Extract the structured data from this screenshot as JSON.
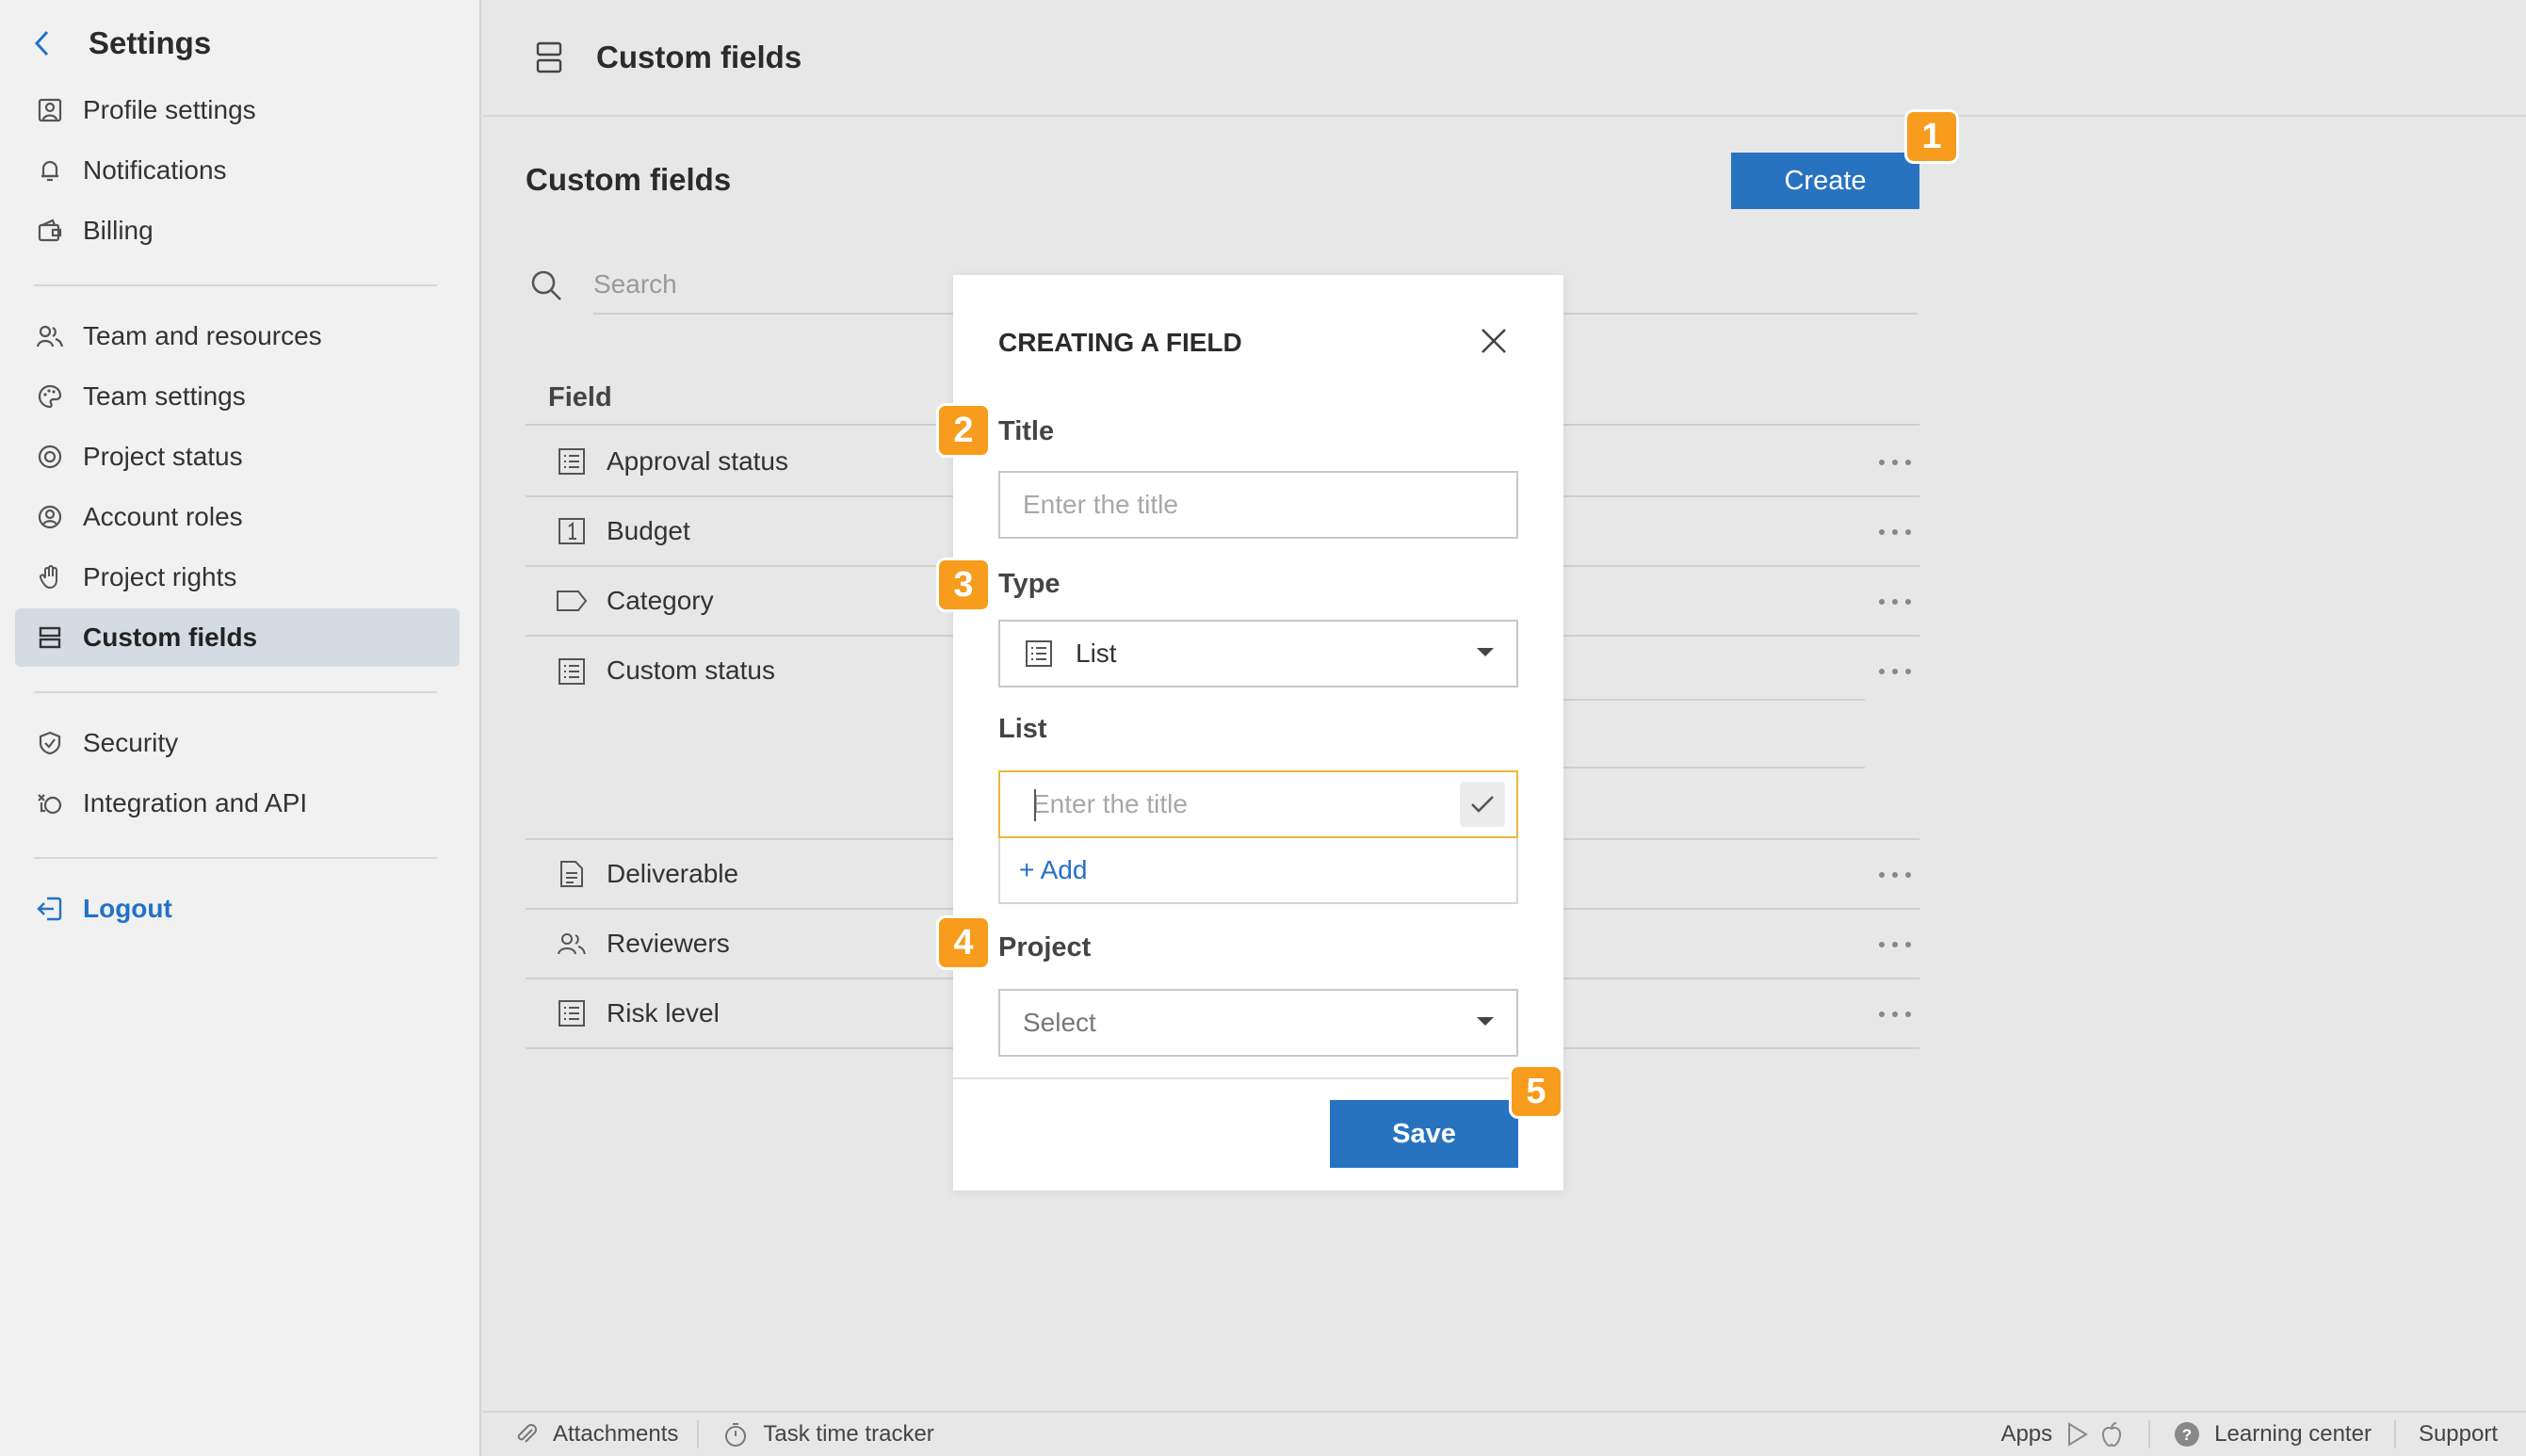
{
  "sidebar": {
    "title": "Settings",
    "items": [
      {
        "label": "Profile settings",
        "icon": "profile-icon"
      },
      {
        "label": "Notifications",
        "icon": "bell-icon"
      },
      {
        "label": "Billing",
        "icon": "wallet-icon"
      },
      {
        "label": "Team and resources",
        "icon": "team-icon"
      },
      {
        "label": "Team settings",
        "icon": "palette-icon"
      },
      {
        "label": "Project status",
        "icon": "project-status-icon"
      },
      {
        "label": "Account roles",
        "icon": "user-circle-icon"
      },
      {
        "label": "Project rights",
        "icon": "hand-icon"
      },
      {
        "label": "Custom fields",
        "icon": "custom-fields-icon",
        "active": true
      },
      {
        "label": "Security",
        "icon": "shield-icon"
      },
      {
        "label": "Integration and API",
        "icon": "integration-icon"
      }
    ],
    "logout": "Logout"
  },
  "header": {
    "title": "Custom fields"
  },
  "main": {
    "section_title": "Custom fields",
    "create_label": "Create",
    "search_placeholder": "Search",
    "table_header": "Field",
    "rows": [
      {
        "label": "Approval status",
        "icon": "list-icon"
      },
      {
        "label": "Budget",
        "icon": "number-icon"
      },
      {
        "label": "Category",
        "icon": "tag-icon"
      },
      {
        "label": "Custom status",
        "icon": "list-icon"
      },
      {
        "label": "Deliverable",
        "icon": "document-icon"
      },
      {
        "label": "Reviewers",
        "icon": "users-icon"
      },
      {
        "label": "Risk level",
        "icon": "list-icon"
      }
    ]
  },
  "modal": {
    "title": "CREATING A FIELD",
    "title_label": "Title",
    "title_placeholder": "Enter the title",
    "type_label": "Type",
    "type_value": "List",
    "list_label": "List",
    "list_placeholder": "Enter the title",
    "add_label": "+ Add",
    "project_label": "Project",
    "project_placeholder": "Select",
    "save_label": "Save"
  },
  "badges": [
    "1",
    "2",
    "3",
    "4",
    "5"
  ],
  "badge_color": "#f79c1c",
  "accent_color": "#2873c0",
  "footer": {
    "attachments": "Attachments",
    "time_tracker": "Task time tracker",
    "apps": "Apps",
    "learning_center": "Learning center",
    "support": "Support"
  }
}
